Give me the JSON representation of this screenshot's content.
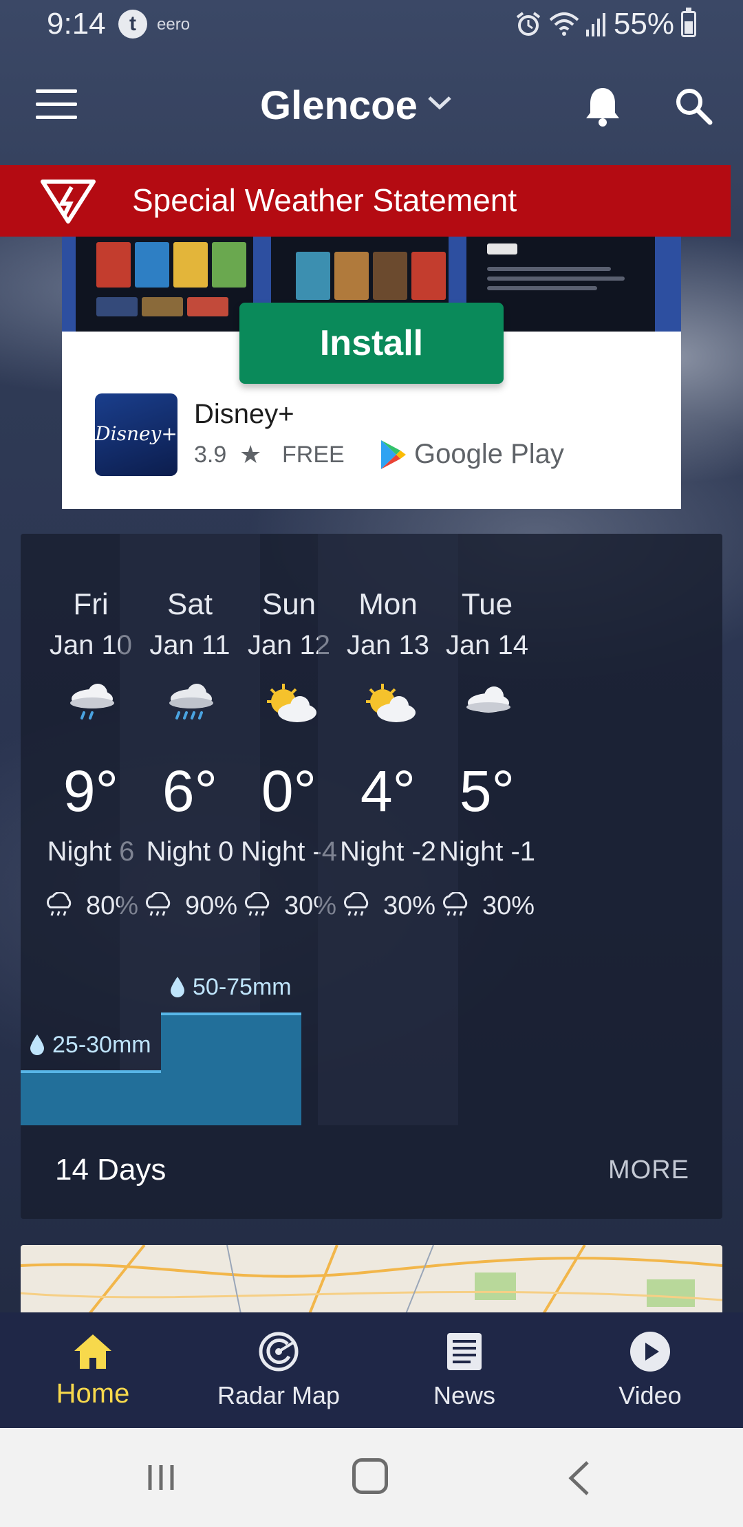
{
  "status_bar": {
    "time": "9:14",
    "app_icon_letter": "t",
    "carrier": "eero",
    "battery": "55%",
    "battery_level": 0.55
  },
  "app_bar": {
    "location": "Glencoe"
  },
  "alert": {
    "text": "Special Weather Statement"
  },
  "ad": {
    "install_label": "Install",
    "app_name": "Disney+",
    "logo_text": "Disney+",
    "rating": "3.9",
    "price": "FREE",
    "store_name": "Google Play"
  },
  "forecast": {
    "days": [
      {
        "day": "Fri",
        "date": "Jan 10",
        "icon": "cloud-rain-light-icon",
        "temp": "9°",
        "night": "Night 6",
        "precip": "80%"
      },
      {
        "day": "Sat",
        "date": "Jan 11",
        "icon": "cloud-rain-heavy-icon",
        "temp": "6°",
        "night": "Night 0",
        "precip": "90%"
      },
      {
        "day": "Sun",
        "date": "Jan 12",
        "icon": "partly-sunny-icon",
        "temp": "0°",
        "night": "Night -4",
        "precip": "30%"
      },
      {
        "day": "Mon",
        "date": "Jan 13",
        "icon": "partly-sunny-icon",
        "temp": "4°",
        "night": "Night -2",
        "precip": "30%"
      },
      {
        "day": "Tue",
        "date": "Jan 14",
        "icon": "cloudy-icon",
        "temp": "5°",
        "night": "Night -1",
        "precip": "30%"
      }
    ],
    "rain_totals": [
      {
        "label": "25-30mm"
      },
      {
        "label": "50-75mm"
      }
    ],
    "days_link": "14 Days",
    "more_link": "MORE"
  },
  "bottom_nav": {
    "items": [
      {
        "label": "Home"
      },
      {
        "label": "Radar Map"
      },
      {
        "label": "News"
      },
      {
        "label": "Video"
      }
    ],
    "active": "Home"
  },
  "colors": {
    "alert_red": "#b40b12",
    "install_green": "#0a8a5a",
    "nav_active": "#f7d94c",
    "rain_bar": "#226f9a"
  }
}
